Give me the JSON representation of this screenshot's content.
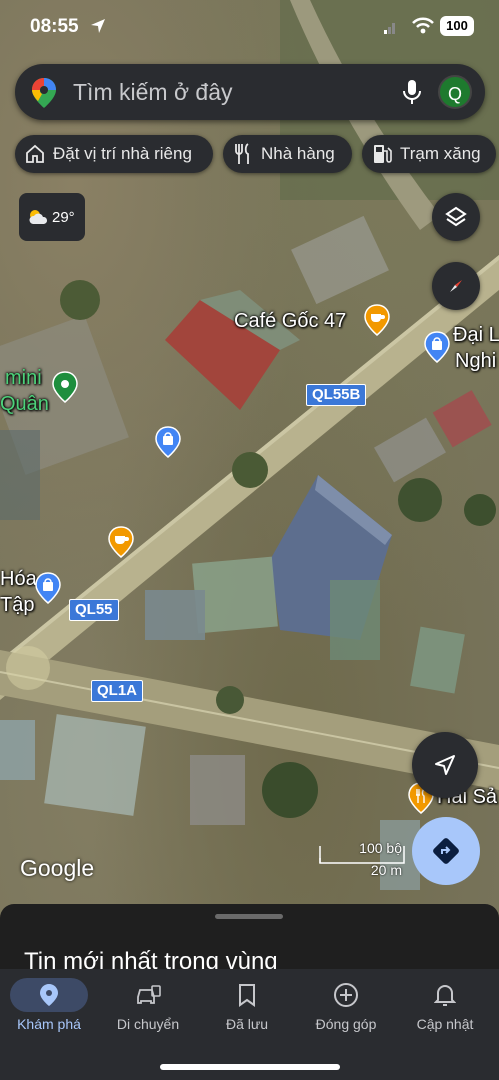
{
  "status_bar": {
    "time": "08:55",
    "battery": "100"
  },
  "search": {
    "placeholder": "Tìm kiếm ở đây",
    "avatar_letter": "Q"
  },
  "chips": [
    {
      "label": "Đặt vị trí nhà riêng",
      "icon": "home-icon"
    },
    {
      "label": "Nhà hàng",
      "icon": "restaurant-icon"
    },
    {
      "label": "Trạm xăng",
      "icon": "gas-station-icon"
    }
  ],
  "weather": {
    "temp": "29°",
    "icon": "partly-cloudy-icon"
  },
  "map": {
    "places": {
      "cafe": "Café Gốc 47",
      "dai_line1": "Đại L",
      "dai_line2": "Nghi",
      "mini_line1": "mini",
      "mini_line2": "Quân",
      "hoa_line1": "Hóa",
      "hoa_line2": "Tập",
      "hai_san": "Hải Sả"
    },
    "roads": {
      "r1": "QL55B",
      "r2": "QL55",
      "r3": "QL1A"
    },
    "attribution": "Google",
    "scale_top": "100 bộ",
    "scale_bottom": "20 m"
  },
  "sheet": {
    "title": "Tin mới nhất trong vùng"
  },
  "nav": [
    {
      "label": "Khám phá",
      "icon": "location-pin-icon",
      "active": true
    },
    {
      "label": "Di chuyển",
      "icon": "car-icon",
      "active": false
    },
    {
      "label": "Đã lưu",
      "icon": "bookmark-icon",
      "active": false
    },
    {
      "label": "Đóng góp",
      "icon": "add-circle-icon",
      "active": false
    },
    {
      "label": "Cập nhật",
      "icon": "bell-icon",
      "active": false
    }
  ],
  "colors": {
    "accent": "#a8c7fa",
    "surface": "#2a2c30",
    "road_shield": "#3b78d8"
  }
}
